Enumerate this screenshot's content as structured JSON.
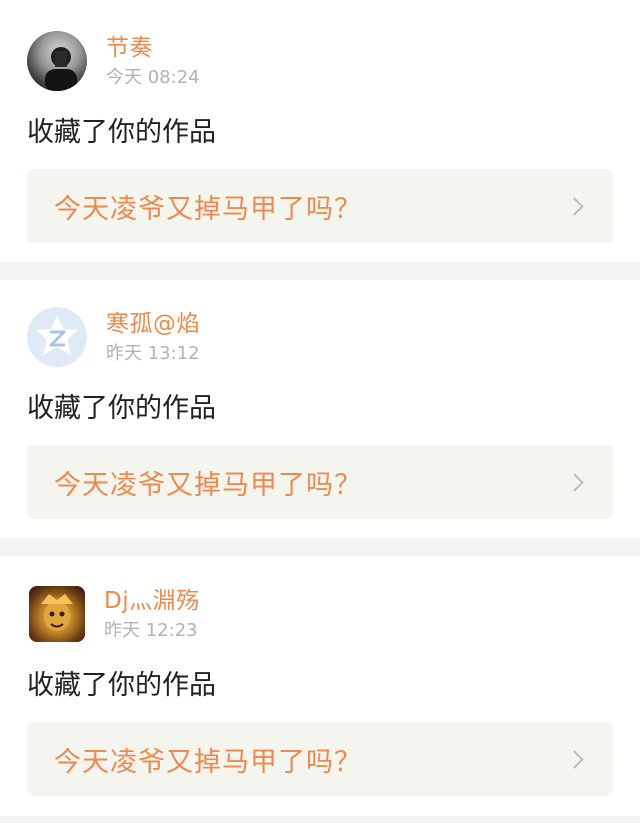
{
  "notifications": [
    {
      "user": "节奏",
      "time": "今天 08:24",
      "action": "收藏了你的作品",
      "work_title": "今天凌爷又掉马甲了吗？",
      "avatar": "dark-portrait-avatar"
    },
    {
      "user": "寒孤@焰",
      "time": "昨天 13:12",
      "action": "收藏了你的作品",
      "work_title": "今天凌爷又掉马甲了吗？",
      "avatar": "qzone-logo-avatar"
    },
    {
      "user": "Dj灬淵殇",
      "time": "昨天 12:23",
      "action": "收藏了你的作品",
      "work_title": "今天凌爷又掉马甲了吗？",
      "avatar": "golden-warrior-avatar"
    }
  ],
  "icons": {
    "chevron": "chevron-right-icon"
  },
  "colors": {
    "accent": "#ee8a4b",
    "muted_text": "#b3b3b3",
    "link_box_bg": "#f5f5f0",
    "page_bg": "#f3f3f3"
  }
}
